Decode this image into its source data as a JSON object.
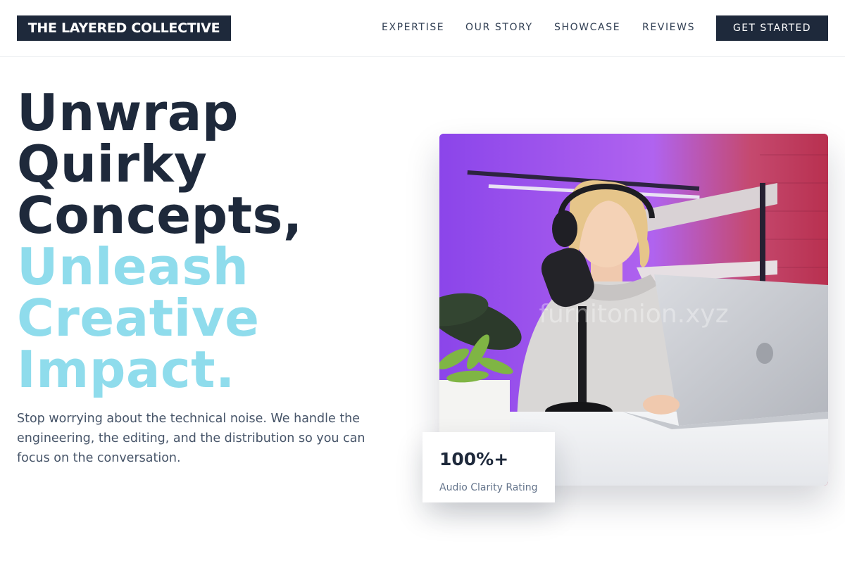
{
  "header": {
    "logo": "THE LAYERED COLLECTIVE",
    "nav": [
      "EXPERTISE",
      "OUR STORY",
      "SHOWCASE",
      "REVIEWS"
    ],
    "cta": "GET STARTED"
  },
  "hero": {
    "headline_dark": [
      "Unwrap",
      "Quirky",
      "Concepts,"
    ],
    "headline_light": [
      "Unleash",
      "Creative",
      "Impact."
    ],
    "subtext": "Stop worrying about the technical noise. We handle the engineering, the editing, and the distribution so you can focus on the conversation.",
    "image_alt": "Woman with headphones speaking into a podcast microphone at a laptop",
    "watermark": "furnitonion.xyz"
  },
  "stat": {
    "value": "100%+",
    "label": "Audio Clarity Rating"
  },
  "colors": {
    "primary": "#1e293b",
    "accent": "#8fdcec",
    "muted": "#475569"
  }
}
